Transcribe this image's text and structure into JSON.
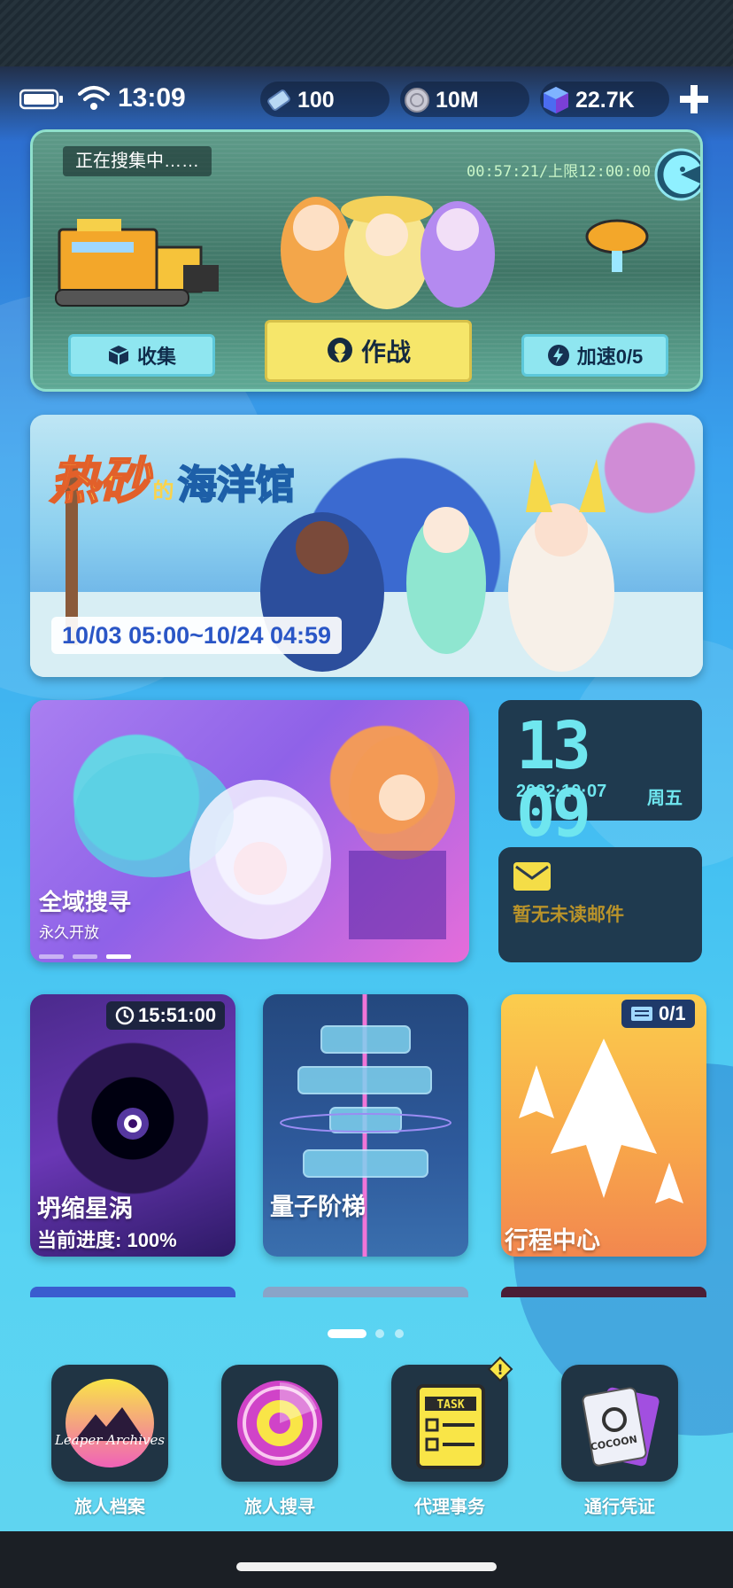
{
  "status_bar": {
    "time": "13:09",
    "currency_ticket": "100",
    "currency_coin": "10M",
    "currency_gem": "22.7K"
  },
  "gather": {
    "status": "正在搜集中……",
    "timer": "00:57:21/上限12:00:00",
    "collect_label": "收集",
    "battle_label": "作战",
    "speedup_label": "加速0/5"
  },
  "event_banner": {
    "title_part1": "热砂",
    "title_de": "的",
    "title_part2": "海洋馆",
    "dates": "10/03 05:00~10/24 04:59"
  },
  "search_tile": {
    "title": "全域搜寻",
    "subtitle": "永久开放"
  },
  "clock": {
    "time": "13 09",
    "date": "2022·10·07",
    "weekday": "周五"
  },
  "mail": {
    "text": "暂无未读邮件"
  },
  "tiles": {
    "vortex": {
      "timer": "15:51:00",
      "title": "坍缩星涡",
      "progress_label": "当前进度:",
      "progress_value": "100%"
    },
    "quantum": {
      "title": "量子阶梯"
    },
    "itinerary": {
      "counter": "0/1",
      "title": "行程中心"
    }
  },
  "dock": [
    {
      "label": "旅人档案",
      "icon": "traveler-archive-icon",
      "logo_text": "Leaper Archives"
    },
    {
      "label": "旅人搜寻",
      "icon": "radar-icon"
    },
    {
      "label": "代理事务",
      "icon": "task-clipboard-icon",
      "logo_text": "TASK",
      "alert": "!"
    },
    {
      "label": "通行凭证",
      "icon": "pass-card-icon",
      "logo_text": "COCOON"
    }
  ],
  "colors": {
    "panel": "#1f3a4f",
    "accent_yellow": "#f6e66a",
    "accent_cyan": "#8fe6f0",
    "clock_digits": "#6fe6ef",
    "mail_text": "#b9932a"
  }
}
